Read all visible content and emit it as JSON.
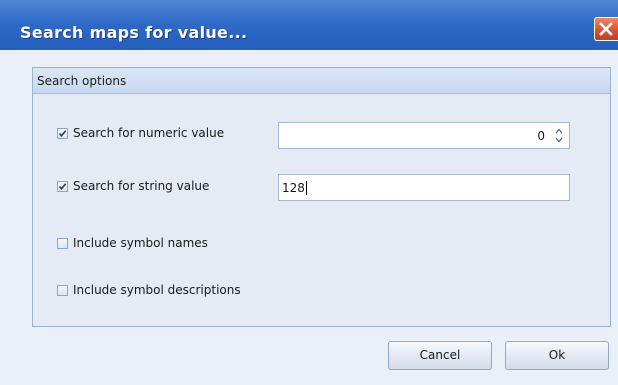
{
  "window": {
    "title": "Search maps for value..."
  },
  "group": {
    "header": "Search options"
  },
  "options": [
    {
      "label": "Search for numeric value",
      "checked": true
    },
    {
      "label": "Search for string value",
      "checked": true
    },
    {
      "label": "Include symbol names",
      "checked": false
    },
    {
      "label": "Include symbol descriptions",
      "checked": false
    }
  ],
  "numeric_input": {
    "value": "0"
  },
  "string_input": {
    "value": "128"
  },
  "buttons": {
    "cancel": "Cancel",
    "ok": "Ok"
  },
  "colors": {
    "titlebar": "#2f6ac8",
    "close": "#d6502f",
    "group_border": "#99b4d1"
  }
}
